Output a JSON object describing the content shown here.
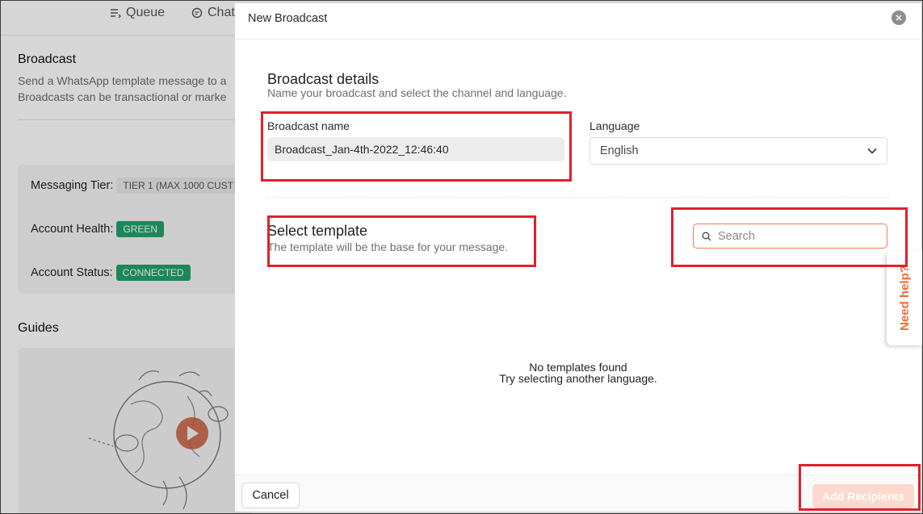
{
  "background": {
    "nav": [
      {
        "label": "Queue",
        "icon": "queue-icon"
      },
      {
        "label": "Chat",
        "icon": "chat-icon"
      }
    ],
    "title": "Broadcast",
    "desc_line1": "Send a WhatsApp template message to a",
    "desc_line2": "Broadcasts can be transactional or marke",
    "messaging_tier_label": "Messaging Tier:",
    "messaging_tier_value": "TIER 1 (MAX 1000 CUST",
    "account_health_label": "Account Health:",
    "account_health_value": "GREEN",
    "account_status_label": "Account Status:",
    "account_status_value": "CONNECTED",
    "guides_title": "Guides"
  },
  "modal": {
    "title": "New Broadcast",
    "details_title": "Broadcast details",
    "details_desc": "Name your broadcast and select the channel and language.",
    "name_label": "Broadcast name",
    "name_value": "Broadcast_Jan-4th-2022_12:46:40",
    "language_label": "Language",
    "language_value": "English",
    "template_title": "Select template",
    "template_desc": "The template will be the base for your message.",
    "search_placeholder": "Search",
    "empty_title": "No templates found",
    "empty_desc": "Try selecting another language.",
    "cancel_label": "Cancel",
    "add_recipients_label": "Add Recipients"
  },
  "help_tab": "Need help?",
  "colors": {
    "accent": "#f26a3a",
    "green": "#22a36a",
    "highlight": "#e0202f"
  }
}
